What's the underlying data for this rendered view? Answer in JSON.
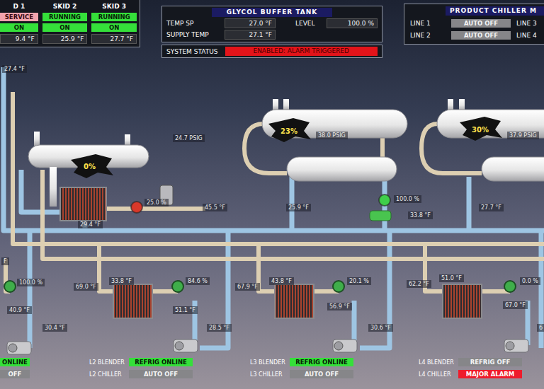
{
  "skid_panel": {
    "skids": [
      {
        "name": "D 1",
        "status": "SERVICE",
        "status_state": "fault",
        "mode": "ON",
        "mode_on": true,
        "temp": "9.4 °F"
      },
      {
        "name": "SKID 2",
        "status": "RUNNING",
        "status_state": "running",
        "mode": "ON",
        "mode_on": true,
        "temp": "25.9 °F"
      },
      {
        "name": "SKID 3",
        "status": "RUNNING",
        "status_state": "running",
        "mode": "ON",
        "mode_on": true,
        "temp": "27.7 °F"
      }
    ]
  },
  "buffer_tank": {
    "title": "GLYCOL BUFFER TANK",
    "temp_sp_label": "TEMP SP",
    "temp_sp": "27.0 °F",
    "level_label": "LEVEL",
    "level": "100.0 %",
    "supply_label": "SUPPLY TEMP",
    "supply_temp": "27.1 °F",
    "status_label": "SYSTEM STATUS",
    "status": "ENABLED: ALARM TRIGGERED",
    "alarm": true
  },
  "chiller_panel": {
    "title": "PRODUCT CHILLER M",
    "rows": [
      {
        "left": "LINE 1",
        "status": "AUTO OFF",
        "right": "LINE 3"
      },
      {
        "left": "LINE 2",
        "status": "AUTO OFF",
        "right": "LINE 4"
      }
    ]
  },
  "diagram": {
    "edge_readings": [
      "27.4 °F",
      "F"
    ],
    "skids": [
      {
        "level": "0%",
        "pressure": "24.7 PSIG",
        "valve_color": "#d8382a",
        "readings": [
          "25.0 %",
          "45.5 °F",
          "29.4 °F"
        ]
      },
      {
        "level": "23%",
        "pressure": "38.0 PSIG",
        "valve_color": "#3fcf4a",
        "readings": [
          "25.9 °F",
          "100.0 %",
          "33.8 °F"
        ]
      },
      {
        "level": "30%",
        "pressure": "37.9 PSIG",
        "readings": [
          "27.7 °F"
        ]
      }
    ],
    "lines": [
      {
        "readings": [
          "100.0 %",
          "40.9 °F",
          "30.4 °F"
        ],
        "valve_color": "#3fae4a",
        "blender_status": "ONLINE",
        "blender_state": "online",
        "chiller_status": "OFF",
        "chiller_state": "off"
      },
      {
        "readings": [
          "69.0 °F",
          "33.8 °F",
          "84.6 %",
          "51.1 °F",
          "28.5 °F"
        ],
        "valve_color": "#3fae4a",
        "blender_label": "L2 BLENDER",
        "blender_status": "REFRIG ONLINE",
        "blender_state": "online",
        "chiller_label": "L2 CHILLER",
        "chiller_status": "AUTO OFF",
        "chiller_state": "off"
      },
      {
        "readings": [
          "67.9 °F",
          "43.8 °F",
          "20.1 %",
          "56.9 °F",
          "30.6 °F"
        ],
        "valve_color": "#3fae4a",
        "blender_label": "L3 BLENDER",
        "blender_status": "REFRIG ONLINE",
        "blender_state": "online",
        "chiller_label": "L3 CHILLER",
        "chiller_status": "AUTO OFF",
        "chiller_state": "off"
      },
      {
        "readings": [
          "62.2 °F",
          "51.0 °F",
          "0.0 %",
          "67.0 °F",
          "6"
        ],
        "valve_color": "#3fae4a",
        "blender_label": "L4 BLENDER",
        "blender_status": "REFRIG OFF",
        "blender_state": "off",
        "chiller_label": "L4 CHILLER",
        "chiller_status": "MAJOR ALARM",
        "chiller_state": "alarm"
      }
    ]
  }
}
